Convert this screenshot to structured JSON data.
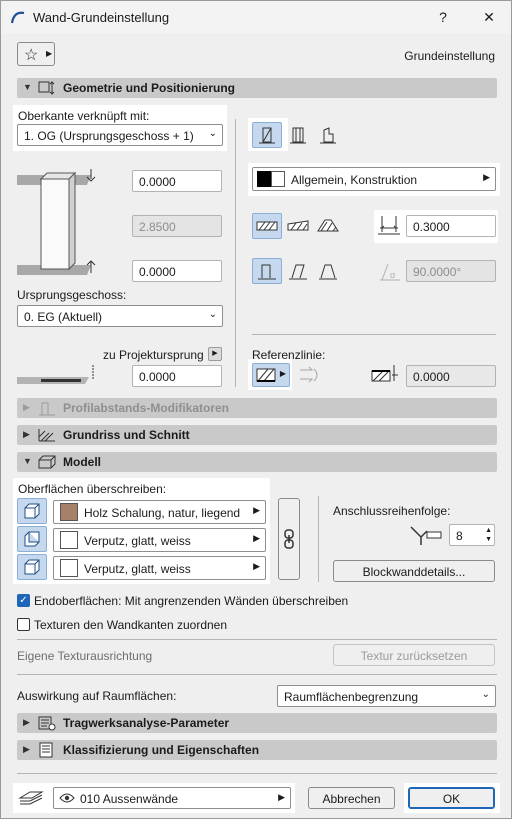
{
  "window": {
    "title": "Wand-Grundeinstellung",
    "help": "?",
    "close": "✕"
  },
  "toolbar": {
    "favorites_icon": "star-icon",
    "mode_label": "Grundeinstellung"
  },
  "sections": {
    "geometry": "Geometrie und Positionierung",
    "profile": "Profilabstands-Modifikatoren",
    "plan": "Grundriss und Schnitt",
    "model": "Modell",
    "structural": "Tragwerksanalyse-Parameter",
    "classification": "Klassifizierung und Eigenschaften"
  },
  "geometry": {
    "top_link_label": "Oberkante verknüpft mit:",
    "top_link_value": "1. OG (Ursprungsgeschoss + 1)",
    "top_offset": "0.0000",
    "height": "2.8500",
    "bottom_offset": "0.0000",
    "home_story_label": "Ursprungsgeschoss:",
    "home_story_value": "0. EG (Aktuell)",
    "project_zero_label": "zu Projektursprung",
    "project_zero_value": "0.0000",
    "building_material": "Allgemein, Konstruktion",
    "thickness": "0.3000",
    "slant_angle": "90.0000°",
    "reference_line_label": "Referenzlinie:",
    "reference_offset": "0.0000"
  },
  "model": {
    "override_label": "Oberflächen überschreiben:",
    "surfaces": [
      {
        "name": "Holz Schalung, natur, liegend",
        "color": "#a68068"
      },
      {
        "name": "Verputz, glatt, weiss",
        "color": "#ffffff"
      },
      {
        "name": "Verputz, glatt, weiss",
        "color": "#ffffff"
      }
    ],
    "connection_order_label": "Anschlussreihenfolge:",
    "connection_order_value": "8",
    "block_details_button": "Blockwanddetails...",
    "end_surfaces_label": "Endoberflächen: Mit angrenzenden Wänden überschreiben",
    "end_surfaces_checked": true,
    "textures_label": "Texturen den Wandkanten zuordnen",
    "textures_checked": false,
    "texture_alignment_label": "Eigene Texturausrichtung",
    "reset_texture_button": "Textur zurücksetzen"
  },
  "zones": {
    "label": "Auswirkung auf Raumflächen:",
    "value": "Raumflächenbegrenzung"
  },
  "footer": {
    "layer_value": "010 Aussenwände",
    "cancel_label": "Abbrechen",
    "ok_label": "OK"
  },
  "colors": {
    "accent": "#1f66b8",
    "section_header": "#c9c9c9",
    "selected_button": "#c6d8ee"
  }
}
